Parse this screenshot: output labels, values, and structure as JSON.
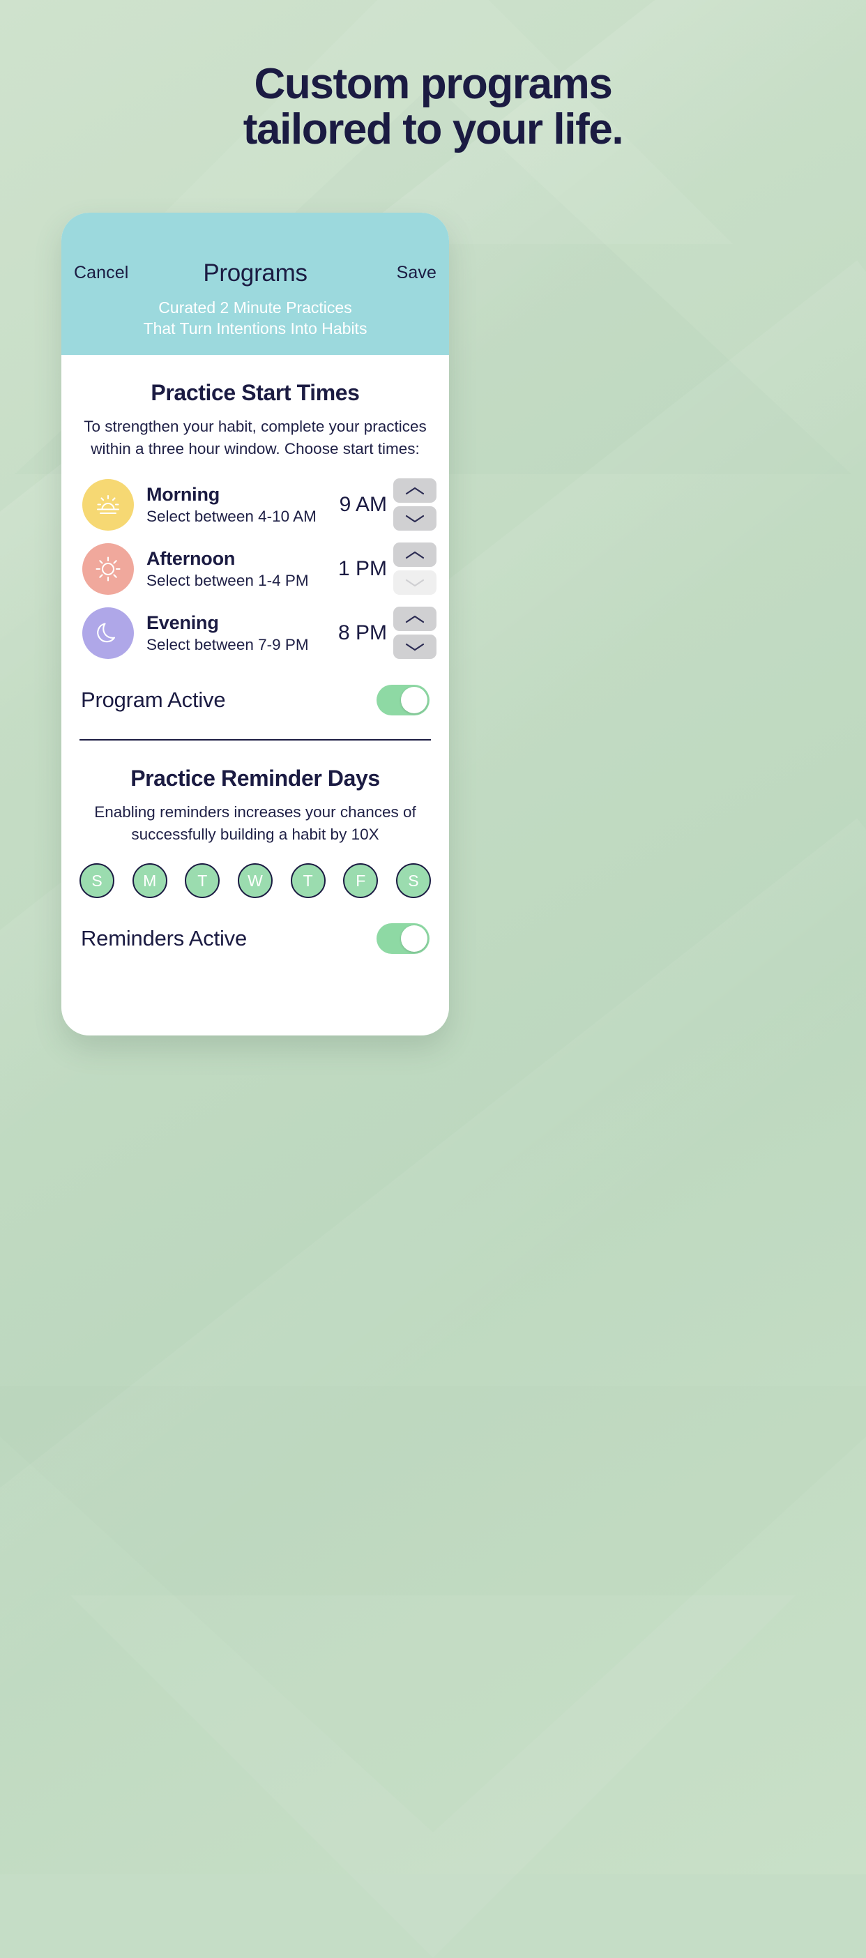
{
  "headline": {
    "line1": "Custom programs",
    "line2": "tailored to your life."
  },
  "phone": {
    "nav": {
      "cancel_label": "Cancel",
      "title": "Programs",
      "save_label": "Save",
      "subtitle_line1": "Curated 2 Minute Practices",
      "subtitle_line2": "That Turn Intentions Into Habits"
    },
    "start_times": {
      "title": "Practice Start Times",
      "description_line1": "To strengthen your habit, complete your practices",
      "description_line2": "within a three hour window. Choose start times:",
      "rows": [
        {
          "name": "Morning",
          "sub": "Select between 4-10 AM",
          "value": "9 AM",
          "icon": "sunrise-icon",
          "icon_bg": "#f6d873",
          "up_enabled": true,
          "down_enabled": true
        },
        {
          "name": "Afternoon",
          "sub": "Select between 1-4 PM",
          "value": "1 PM",
          "icon": "sun-icon",
          "icon_bg": "#f0a89c",
          "up_enabled": true,
          "down_enabled": false
        },
        {
          "name": "Evening",
          "sub": "Select between 7-9 PM",
          "value": "8 PM",
          "icon": "moon-icon",
          "icon_bg": "#afa7e8",
          "up_enabled": true,
          "down_enabled": true
        }
      ],
      "toggle_label": "Program Active",
      "toggle_on": true
    },
    "reminder_days": {
      "title": "Practice Reminder Days",
      "description_line1": "Enabling reminders increases your chances of",
      "description_line2": "successfully building a habit by 10X",
      "days": [
        {
          "label": "S",
          "selected": true
        },
        {
          "label": "M",
          "selected": true
        },
        {
          "label": "T",
          "selected": true
        },
        {
          "label": "W",
          "selected": true
        },
        {
          "label": "T",
          "selected": true
        },
        {
          "label": "F",
          "selected": true
        },
        {
          "label": "S",
          "selected": true
        }
      ],
      "toggle_label": "Reminders Active",
      "toggle_on": true
    }
  },
  "colors": {
    "background": "#c5ddc6",
    "header_teal": "#9cd9dd",
    "ink": "#1b1b42",
    "toggle_green": "#8ed9a4",
    "day_green": "#9bdcaf"
  }
}
